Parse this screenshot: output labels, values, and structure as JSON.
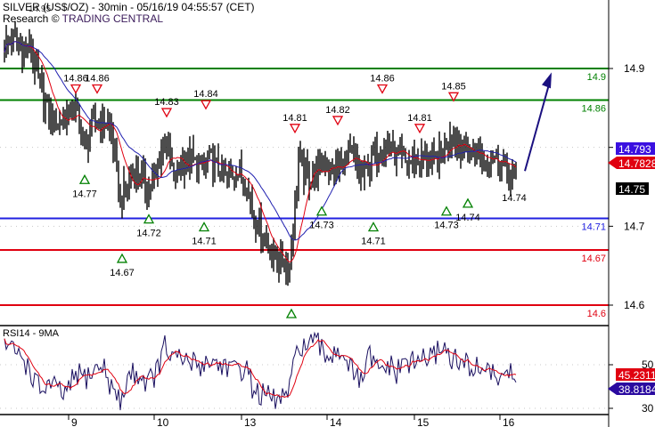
{
  "header": {
    "title": "SILVER (US$/OZ) - 30min - 05/16/19 04:55:57 (CET)",
    "research_prefix": "Research © ",
    "brand": "TRADING CENTRAL",
    "overlap_label": "14.95"
  },
  "chart_data": [
    {
      "type": "ohlc",
      "title": "SILVER (US$/OZ) - 30min",
      "ylim": [
        14.57,
        14.97
      ],
      "y_ticks": [
        "14.9",
        "14.8",
        "14.7",
        "14.6"
      ],
      "y_tick_values": [
        14.9,
        14.8,
        14.7,
        14.6
      ],
      "x_ticks": [
        {
          "label": "9",
          "bar": 36
        },
        {
          "label": "10",
          "bar": 84
        },
        {
          "label": "13",
          "bar": 133
        },
        {
          "label": "14",
          "bar": 181
        },
        {
          "label": "15",
          "bar": 230
        },
        {
          "label": "16",
          "bar": 278
        }
      ],
      "bars_count": 288,
      "price_path_every_5_bars": [
        14.93,
        14.936,
        14.92,
        14.925,
        14.874,
        14.84,
        14.83,
        14.84,
        14.85,
        14.8,
        14.83,
        14.835,
        14.82,
        14.73,
        14.76,
        14.77,
        14.75,
        14.76,
        14.82,
        14.76,
        14.78,
        14.785,
        14.77,
        14.785,
        14.77,
        14.76,
        14.77,
        14.76,
        14.715,
        14.69,
        14.665,
        14.655,
        14.65,
        14.785,
        14.76,
        14.77,
        14.78,
        14.77,
        14.78,
        14.79,
        14.76,
        14.78,
        14.795,
        14.805,
        14.785,
        14.78,
        14.785,
        14.785,
        14.78,
        14.79,
        14.82,
        14.805,
        14.79,
        14.795,
        14.785,
        14.79,
        14.78,
        14.76
      ],
      "levels": [
        {
          "value": 14.9,
          "label": "14.9",
          "color": "#008000"
        },
        {
          "value": 14.86,
          "label": "14.86",
          "color": "#008000"
        },
        {
          "value": 14.71,
          "label": "14.71",
          "color": "#2020e0"
        },
        {
          "value": 14.67,
          "label": "14.67",
          "color": "#e00010"
        },
        {
          "value": 14.6,
          "label": "14.6",
          "color": "#e00010"
        }
      ],
      "resistance_marks": [
        {
          "bar": 40,
          "label": "14.86",
          "value": 14.86
        },
        {
          "bar": 52,
          "label": "14.86",
          "value": 14.86
        },
        {
          "bar": 91,
          "label": "14.83",
          "value": 14.83
        },
        {
          "bar": 113,
          "label": "14.84",
          "value": 14.84
        },
        {
          "bar": 163,
          "label": "14.81",
          "value": 14.81
        },
        {
          "bar": 187,
          "label": "14.82",
          "value": 14.82
        },
        {
          "bar": 212,
          "label": "14.86",
          "value": 14.86
        },
        {
          "bar": 233,
          "label": "14.81",
          "value": 14.81
        },
        {
          "bar": 252,
          "label": "14.85",
          "value": 14.85
        }
      ],
      "support_marks": [
        {
          "bar": 45,
          "label": "14.77",
          "value": 14.77
        },
        {
          "bar": 66,
          "label": "14.67",
          "value": 14.67
        },
        {
          "bar": 81,
          "label": "14.72",
          "value": 14.72
        },
        {
          "bar": 112,
          "label": "14.71",
          "value": 14.71
        },
        {
          "bar": 161,
          "label": "",
          "value": 14.6
        },
        {
          "bar": 178,
          "label": "14.73",
          "value": 14.73
        },
        {
          "bar": 207,
          "label": "14.71",
          "value": 14.71
        },
        {
          "bar": 248,
          "label": "14.73",
          "value": 14.73
        },
        {
          "bar": 260,
          "label": "14.74",
          "value": 14.74
        }
      ],
      "extra_labels": [
        {
          "bar": 289,
          "label": "14.74",
          "value": 14.74
        }
      ],
      "forecast_arrow": {
        "from_bar": 292,
        "from_value": 14.77,
        "to_bar": 307,
        "to_value": 14.895,
        "color": "#1a1080"
      },
      "badges": [
        {
          "label": "14.793",
          "value": 14.793,
          "bg": "#3a10e0",
          "fg": "#ffffff",
          "shape": "box"
        },
        {
          "label": "14.7828",
          "value": 14.7828,
          "bg": "#e00010",
          "fg": "#ffffff",
          "shape": "arrow"
        },
        {
          "label": "14.75",
          "value": 14.75,
          "bg": "#000000",
          "fg": "#ffffff",
          "shape": "box"
        }
      ],
      "ma_fast_color": "#e00010",
      "ma_slow_color": "#2020b0"
    },
    {
      "type": "line",
      "title": "RSI14 - 9MA",
      "ylim": [
        26,
        70
      ],
      "y_ticks": [
        "50",
        "30"
      ],
      "y_tick_values": [
        50,
        30
      ],
      "rsi_path_every_5_bars": [
        60,
        56,
        54,
        46,
        38,
        41,
        38,
        36,
        46,
        44,
        47,
        50,
        40,
        32,
        46,
        46,
        42,
        46,
        58,
        52,
        52,
        51,
        50,
        52,
        50,
        50,
        46,
        50,
        38,
        36,
        34,
        34,
        38,
        60,
        58,
        60,
        54,
        56,
        57,
        46,
        42,
        54,
        46,
        50,
        46,
        52,
        50,
        54,
        52,
        60,
        54,
        50,
        50,
        48,
        50,
        43,
        48,
        44,
        41
      ],
      "series": [
        {
          "name": "RSI14",
          "color": "#1a1060"
        },
        {
          "name": "9MA",
          "color": "#e00010"
        }
      ],
      "badges": [
        {
          "label": "45.2311",
          "value": 45.2311,
          "bg": "#e00010",
          "fg": "#ffffff",
          "shape": "box"
        },
        {
          "label": "38.8184",
          "value": 38.8184,
          "bg": "#2a0aa0",
          "fg": "#ffffff",
          "shape": "arrow"
        }
      ]
    }
  ]
}
